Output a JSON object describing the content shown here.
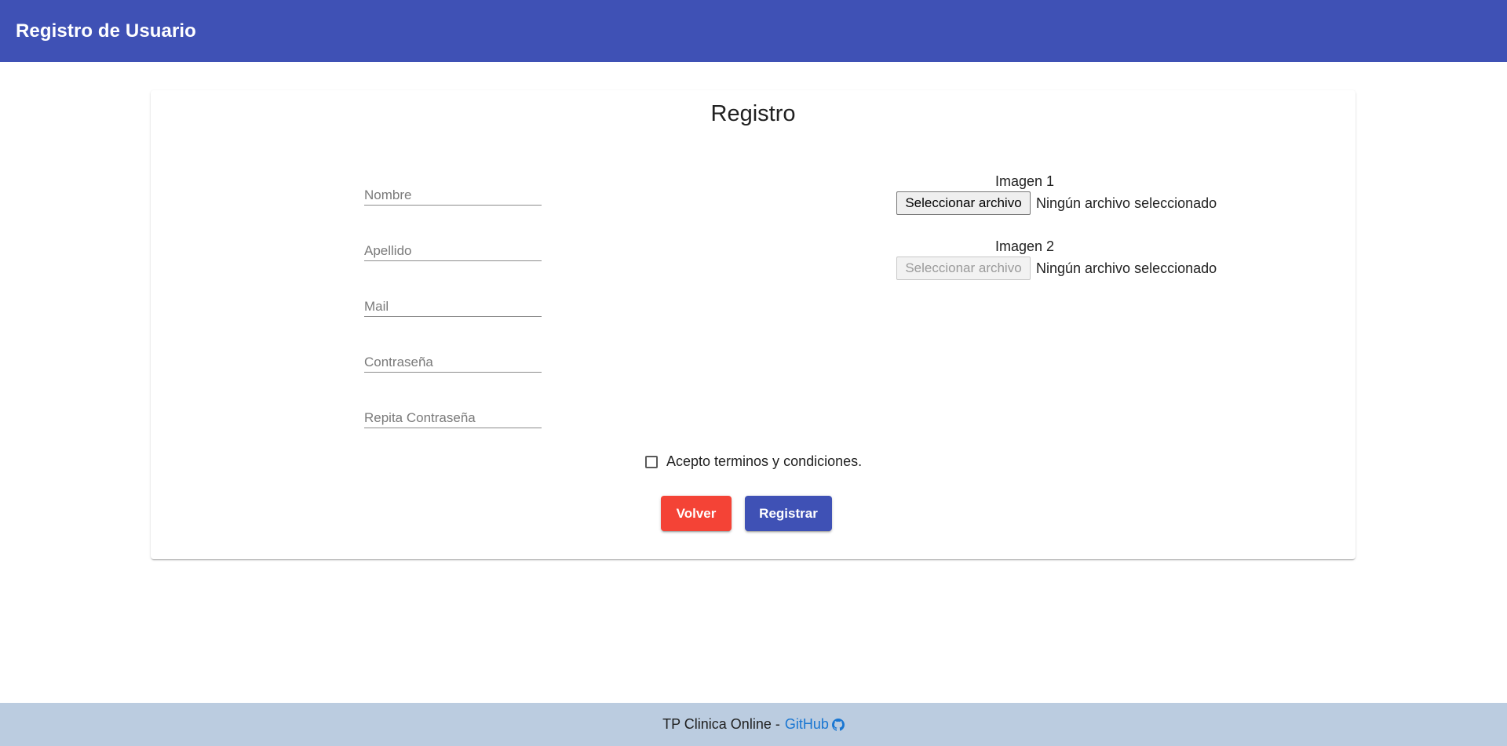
{
  "header": {
    "title": "Registro de Usuario"
  },
  "card": {
    "title": "Registro"
  },
  "form": {
    "fields": [
      {
        "placeholder": "Nombre",
        "value": ""
      },
      {
        "placeholder": "Apellido",
        "value": ""
      },
      {
        "placeholder": "Mail",
        "value": ""
      },
      {
        "placeholder": "Contraseña",
        "value": ""
      },
      {
        "placeholder": "Repita Contraseña",
        "value": ""
      }
    ],
    "images": [
      {
        "label": "Imagen 1",
        "button_label": "Seleccionar archivo",
        "status": "Ningún archivo seleccionado",
        "enabled": true
      },
      {
        "label": "Imagen 2",
        "button_label": "Seleccionar archivo",
        "status": "Ningún archivo seleccionado",
        "enabled": false
      }
    ],
    "terms_label": "Acepto terminos y condiciones.",
    "terms_checked": false,
    "back_label": "Volver",
    "submit_label": "Registrar"
  },
  "footer": {
    "text": "TP Clinica Online -",
    "link_label": "GitHub",
    "icon": "github-icon"
  },
  "colors": {
    "primary": "#3f51b5",
    "warn": "#f44336",
    "footer_bg": "#bbcce0",
    "link": "#1976d2"
  }
}
